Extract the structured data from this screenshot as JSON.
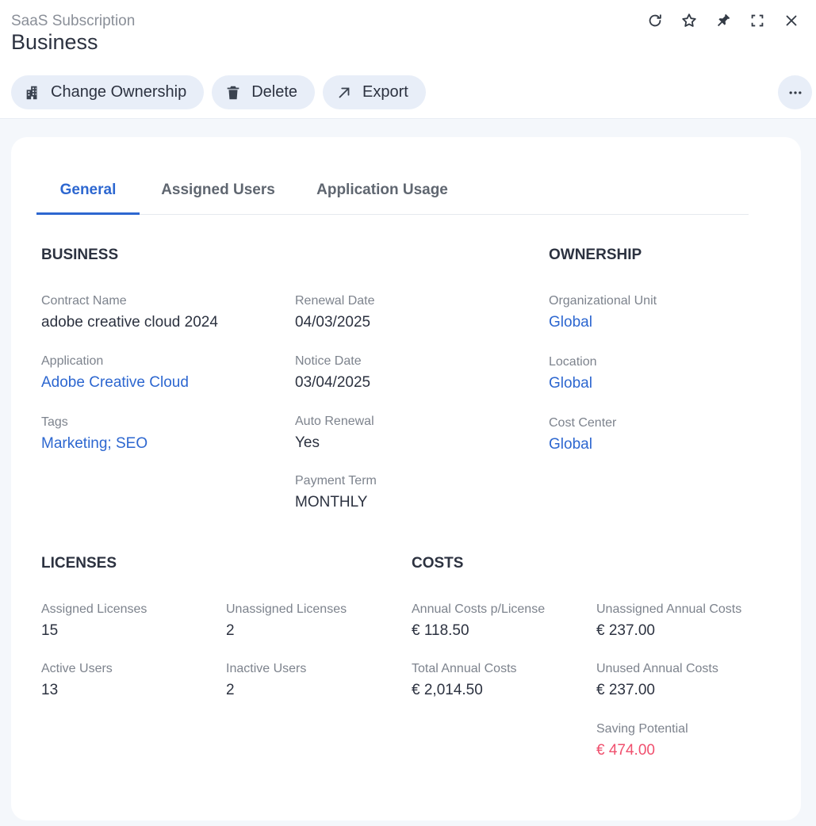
{
  "header": {
    "subtitle": "SaaS Subscription",
    "title": "Business"
  },
  "window_icons": [
    "refresh-icon",
    "star-icon",
    "pin-icon",
    "fullscreen-icon",
    "close-icon"
  ],
  "toolbar": {
    "change_ownership": "Change Ownership",
    "delete": "Delete",
    "export": "Export"
  },
  "tabs": [
    {
      "label": "General",
      "active": true
    },
    {
      "label": "Assigned Users",
      "active": false
    },
    {
      "label": "Application Usage",
      "active": false
    }
  ],
  "business": {
    "heading": "BUSINESS",
    "contract_name": {
      "label": "Contract Name",
      "value": "adobe creative cloud 2024"
    },
    "application": {
      "label": "Application",
      "value": "Adobe Creative Cloud"
    },
    "tags": {
      "label": "Tags",
      "value": "Marketing; SEO"
    },
    "renewal_date": {
      "label": "Renewal Date",
      "value": "04/03/2025"
    },
    "notice_date": {
      "label": "Notice Date",
      "value": "03/04/2025"
    },
    "auto_renewal": {
      "label": "Auto Renewal",
      "value": "Yes"
    },
    "payment_term": {
      "label": "Payment Term",
      "value": "MONTHLY"
    }
  },
  "ownership": {
    "heading": "OWNERSHIP",
    "org_unit": {
      "label": "Organizational Unit",
      "value": "Global"
    },
    "location": {
      "label": "Location",
      "value": "Global"
    },
    "cost_center": {
      "label": "Cost Center",
      "value": "Global"
    }
  },
  "licenses": {
    "heading": "LICENSES",
    "assigned": {
      "label": "Assigned Licenses",
      "value": "15"
    },
    "unassigned": {
      "label": "Unassigned Licenses",
      "value": "2"
    },
    "active_users": {
      "label": "Active Users",
      "value": "13"
    },
    "inactive_users": {
      "label": "Inactive Users",
      "value": "2"
    }
  },
  "costs": {
    "heading": "COSTS",
    "annual_per_license": {
      "label": "Annual Costs p/License",
      "value": "€ 118.50"
    },
    "total_annual": {
      "label": "Total Annual Costs",
      "value": "€ 2,014.50"
    },
    "unassigned_annual": {
      "label": "Unassigned Annual Costs",
      "value": "€ 237.00"
    },
    "unused_annual": {
      "label": "Unused Annual Costs",
      "value": "€ 237.00"
    },
    "saving_potential": {
      "label": "Saving Potential",
      "value": "€ 474.00"
    }
  },
  "colors": {
    "accent": "#2d67d0",
    "danger": "#f0506e",
    "button_bg": "#e8eef8",
    "page_bg": "#f4f7fb"
  }
}
